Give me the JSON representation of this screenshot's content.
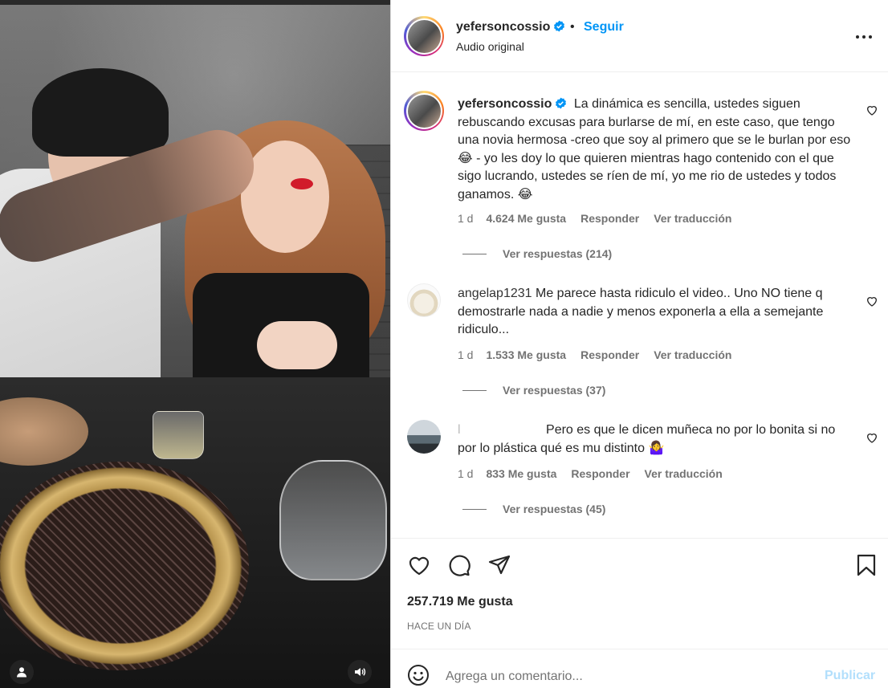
{
  "colors": {
    "accent": "#0095f6",
    "text": "#262626",
    "secondary": "#737373",
    "publish_disabled": "#b2dffc"
  },
  "media": {
    "user_icon": "user-icon",
    "audio_icon": "speaker-icon"
  },
  "header": {
    "username": "yefersoncossio",
    "dot": "•",
    "follow_label": "Seguir",
    "subtitle": "Audio original",
    "more_icon": "more-options-icon"
  },
  "comments": [
    {
      "username": "yefersoncossio",
      "verified": true,
      "text": "La dinámica es sencilla, ustedes siguen rebuscando excusas para burlarse de mí, en este caso, que tengo una novia hermosa -creo que soy al primero que se le burlan por eso 😂 - yo les doy lo que quieren mientras hago contenido con el que sigo lucrando, ustedes se ríen de mí, yo me rio de ustedes y todos ganamos. 😂",
      "time": "1 d",
      "likes": "4.624 Me gusta",
      "reply": "Responder",
      "translate": "Ver traducción",
      "replies": "Ver respuestas (214)"
    },
    {
      "username": "angelap1231",
      "verified": false,
      "text": "Me parece hasta ridiculo el video.. Uno NO tiene q demostrarle nada a nadie y menos exponerla a ella a semejante ridiculo...",
      "time": "1 d",
      "likes": "1.533 Me gusta",
      "reply": "Responder",
      "translate": "Ver traducción",
      "replies": "Ver respuestas (37)"
    },
    {
      "username": "l",
      "verified": false,
      "text": "Pero es que le dicen muñeca no por lo bonita si no por lo plástica qué es mu distinto 🤷‍♀️",
      "time": "1 d",
      "likes": "833 Me gusta",
      "reply": "Responder",
      "translate": "Ver traducción",
      "replies": "Ver respuestas (45)"
    }
  ],
  "actions": {
    "like_icon": "heart-icon",
    "comment_icon": "comment-icon",
    "share_icon": "share-icon",
    "save_icon": "bookmark-icon",
    "likes": "257.719 Me gusta",
    "date": "HACE UN DÍA"
  },
  "composer": {
    "emoji_icon": "emoji-icon",
    "placeholder": "Agrega un comentario...",
    "publish_label": "Publicar"
  }
}
